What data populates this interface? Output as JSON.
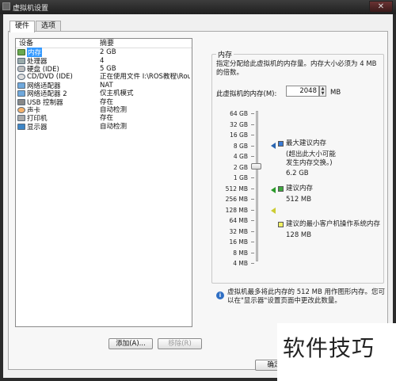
{
  "window": {
    "title": "虚拟机设置",
    "close_glyph": "✕"
  },
  "tabs": [
    {
      "label": "硬件",
      "active": true
    },
    {
      "label": "选项",
      "active": false
    }
  ],
  "devices": {
    "columns": {
      "device": "设备",
      "summary": "摘要"
    },
    "rows": [
      {
        "icon": "memory-icon",
        "name": "内存",
        "summary": "2 GB",
        "selected": true
      },
      {
        "icon": "cpu-icon",
        "name": "处理器",
        "summary": "4"
      },
      {
        "icon": "hard-disk-icon",
        "name": "硬盘 (IDE)",
        "summary": "5 GB"
      },
      {
        "icon": "cd-dvd-icon",
        "name": "CD/DVD (IDE)",
        "summary": "正在使用文件 I:\\ROS教程\\Rout..."
      },
      {
        "icon": "network-adapter-icon",
        "name": "网络适配器",
        "summary": "NAT"
      },
      {
        "icon": "network-adapter-icon",
        "name": "网络适配器 2",
        "summary": "仅主机模式"
      },
      {
        "icon": "usb-controller-icon",
        "name": "USB 控制器",
        "summary": "存在"
      },
      {
        "icon": "sound-card-icon",
        "name": "声卡",
        "summary": "自动检测"
      },
      {
        "icon": "printer-icon",
        "name": "打印机",
        "summary": "存在"
      },
      {
        "icon": "display-icon",
        "name": "显示器",
        "summary": "自动检测"
      }
    ],
    "add_button": "添加(A)...",
    "remove_button": "移除(R)"
  },
  "memory": {
    "group_title": "内存",
    "description": "指定分配给此虚拟机的内存量。内存大小必须为 4 MB 的倍数。",
    "field_label": "此虚拟机的内存(M):",
    "value": "2048",
    "unit": "MB",
    "spin_up": "▲",
    "spin_down": "▼",
    "scale": [
      "64 GB",
      "32 GB",
      "16 GB",
      "8 GB",
      "4 GB",
      "2 GB",
      "1 GB",
      "512 MB",
      "256 MB",
      "128 MB",
      "64 MB",
      "32 MB",
      "16 MB",
      "8 MB",
      "4 MB"
    ],
    "max_label": "最大建议内存",
    "max_note": "(超出此大小可能发生内存交换。)",
    "max_value": "6.2 GB",
    "rec_label": "建议内存",
    "rec_value": "512 MB",
    "min_label": "建议的最小客户机操作系统内存",
    "min_value": "128 MB",
    "colors": {
      "max": "#3a7bd5",
      "recommended": "#3da83d",
      "minimum": "#f2f266"
    }
  },
  "info": {
    "icon_glyph": "i",
    "text": "虚拟机最多将此内存的 512 MB 用作图形内存。您可以在\"显示器\"设置页面中更改此数量。"
  },
  "footer": {
    "ok_button": "确定"
  },
  "watermark": {
    "text": "软件技巧"
  }
}
